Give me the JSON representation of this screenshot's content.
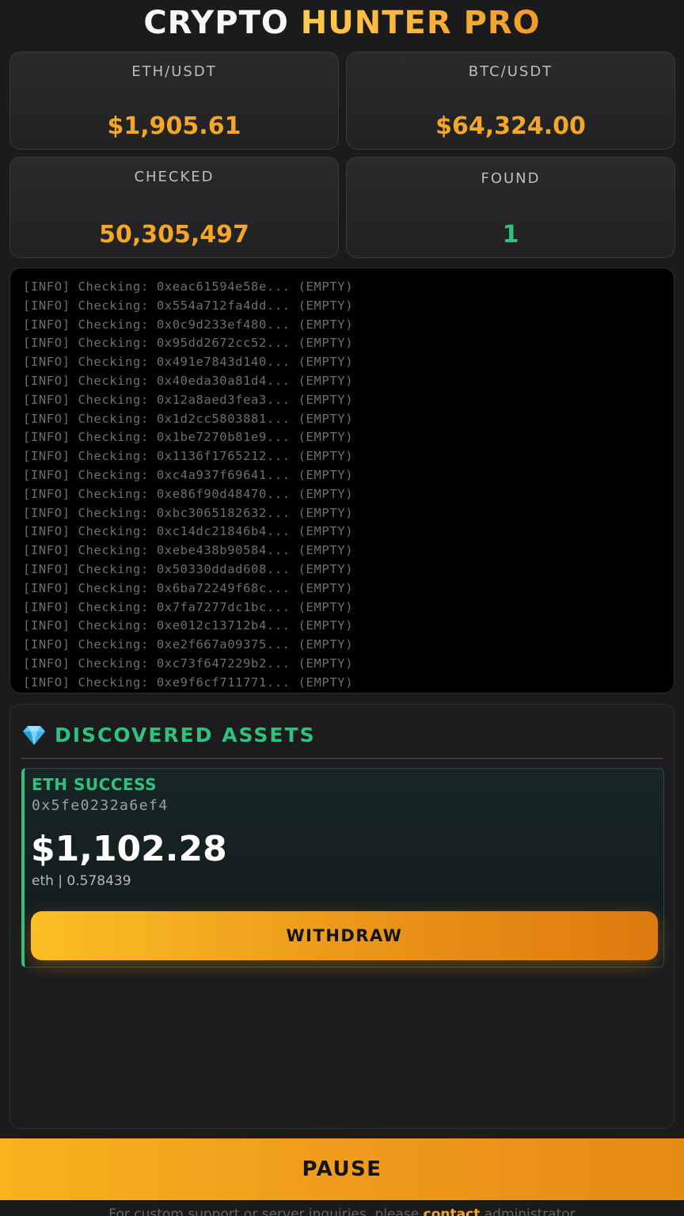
{
  "header": {
    "title_part1": "CRYPTO",
    "title_part2": "HUNTER PRO"
  },
  "stats": [
    {
      "label": "ETH/USDT",
      "value": "$1,905.61",
      "color": "#f4a626"
    },
    {
      "label": "BTC/USDT",
      "value": "$64,324.00",
      "color": "#f4a626"
    },
    {
      "label": "CHECKED",
      "value": "50,305,497",
      "color": "#f4a626"
    },
    {
      "label": "FOUND",
      "value": "1",
      "color": "#2ec27e"
    }
  ],
  "log_lines": [
    "[INFO] Checking: 0xeac61594e58e... (EMPTY)",
    "[INFO] Checking: 0x554a712fa4dd... (EMPTY)",
    "[INFO] Checking: 0x0c9d233ef480... (EMPTY)",
    "[INFO] Checking: 0x95dd2672cc52... (EMPTY)",
    "[INFO] Checking: 0x491e7843d140... (EMPTY)",
    "[INFO] Checking: 0x40eda30a81d4... (EMPTY)",
    "[INFO] Checking: 0x12a8aed3fea3... (EMPTY)",
    "[INFO] Checking: 0x1d2cc5803881... (EMPTY)",
    "[INFO] Checking: 0x1be7270b81e9... (EMPTY)",
    "[INFO] Checking: 0x1136f1765212... (EMPTY)",
    "[INFO] Checking: 0xc4a937f69641... (EMPTY)",
    "[INFO] Checking: 0xe86f90d48470... (EMPTY)",
    "[INFO] Checking: 0xbc3065182632... (EMPTY)",
    "[INFO] Checking: 0xc14dc21846b4... (EMPTY)",
    "[INFO] Checking: 0xebe438b90584... (EMPTY)",
    "[INFO] Checking: 0x50330ddad608... (EMPTY)",
    "[INFO] Checking: 0x6ba72249f68c... (EMPTY)",
    "[INFO] Checking: 0x7fa7277dc1bc... (EMPTY)",
    "[INFO] Checking: 0xe012c13712b4... (EMPTY)",
    "[INFO] Checking: 0xe2f667a09375... (EMPTY)",
    "[INFO] Checking: 0xc73f647229b2... (EMPTY)",
    "[INFO] Checking: 0xe9f6cf711771... (EMPTY)"
  ],
  "assets": {
    "icon": "gem-icon",
    "title": "DISCOVERED ASSETS",
    "items": [
      {
        "status": "ETH SUCCESS",
        "address": "0x5fe0232a6ef4",
        "usd_value": "$1,102.28",
        "detail": "eth | 0.578439",
        "action_label": "WITHDRAW"
      }
    ]
  },
  "controls": {
    "pause_label": "PAUSE"
  },
  "footer": {
    "text_before": "For custom support or server inquiries, please",
    "link_text": "contact",
    "text_after": "administrator"
  },
  "colors": {
    "accent_orange": "#f4a626",
    "accent_green": "#2ec27e",
    "background": "#1b1b1c"
  }
}
